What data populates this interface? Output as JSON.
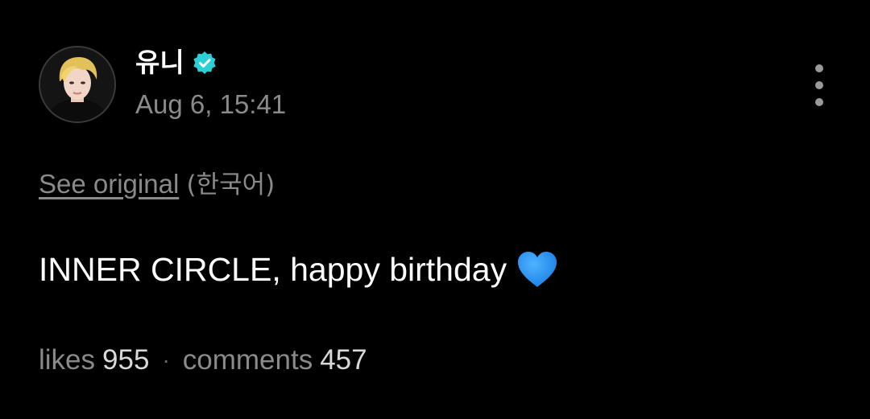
{
  "post": {
    "author": {
      "name": "유니",
      "verified": true,
      "verified_color": "#2bd0d6"
    },
    "timestamp": "Aug 6, 15:41",
    "translation": {
      "link_label": "See original",
      "language": "(한국어)"
    },
    "text": "INNER CIRCLE, happy birthday",
    "emoji": "blue-heart-icon",
    "emoji_color": "#1e90ff",
    "stats": {
      "likes_label": "likes",
      "likes_count": "955",
      "separator": "·",
      "comments_label": "comments",
      "comments_count": "457"
    }
  }
}
